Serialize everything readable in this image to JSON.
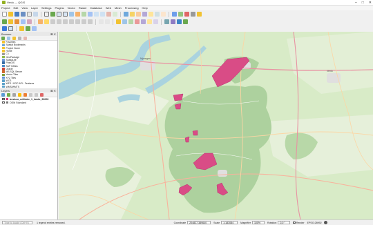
{
  "window": {
    "title": "Venlo — QGIS",
    "controls": [
      "–",
      "□",
      "✕"
    ]
  },
  "menu": [
    "Project",
    "Edit",
    "View",
    "Layer",
    "Settings",
    "Plugins",
    "Vector",
    "Raster",
    "Database",
    "Web",
    "Mesh",
    "Processing",
    "Help"
  ],
  "browser": {
    "title": "Browser",
    "close": "⊠ ✕",
    "items": [
      {
        "label": "Favorites",
        "color": "#f2c230"
      },
      {
        "label": "Spatial Bookmarks",
        "color": "#6fa6d8"
      },
      {
        "label": "Project Home",
        "color": "#f2c230"
      },
      {
        "label": "Home",
        "color": "#f2c230"
      },
      {
        "label": "C:\\",
        "color": "#999999"
      },
      {
        "label": "GeoPackage",
        "color": "#8fb84b"
      },
      {
        "label": "SpatiaLite",
        "color": "#6f9ad8"
      },
      {
        "label": "PostGIS",
        "color": "#3a6ea5"
      },
      {
        "label": "SAP HANA",
        "color": "#4a8bc9"
      },
      {
        "label": "Oracle",
        "color": "#c9473b"
      },
      {
        "label": "MS SQL Server",
        "color": "#d06a2e"
      },
      {
        "label": "Vector Tiles",
        "color": "#7d9e3c"
      },
      {
        "label": "XYZ Tiles",
        "color": "#5c8fd6"
      },
      {
        "label": "WCS",
        "color": "#5aa0c9"
      },
      {
        "label": "WFS / OGC API - Features",
        "color": "#5aa0c9"
      },
      {
        "label": "WMS/WMTS",
        "color": "#5aa0c9"
      }
    ]
  },
  "layers": {
    "title": "Layers",
    "close": "⊠ ✕",
    "items": [
      {
        "label": "bestuur_militaire_1_lands_90000",
        "bold": true,
        "swatch": "#d63573",
        "checked": "✓"
      },
      {
        "label": "OSM Standard",
        "bold": false,
        "swatch": "#777777",
        "checked": "✓"
      }
    ]
  },
  "map": {
    "polygon_color": "#d94c86",
    "place_labels": [
      "Nijmegen",
      "Venlo"
    ]
  },
  "status": {
    "locator_placeholder": "Type to locate (Ctrl+K)",
    "message": "1 legend entries removed.",
    "coordinate_label": "Coordinate",
    "coordinate_value": "204827,389640",
    "scale_label": "Scale",
    "scale_value": "1:183084",
    "magnifier_label": "Magnifier",
    "magnifier_value": "100%",
    "rotation_label": "Rotation",
    "rotation_value": "0,0 °",
    "render_label": "Render",
    "crs": "EPSG:28992"
  }
}
